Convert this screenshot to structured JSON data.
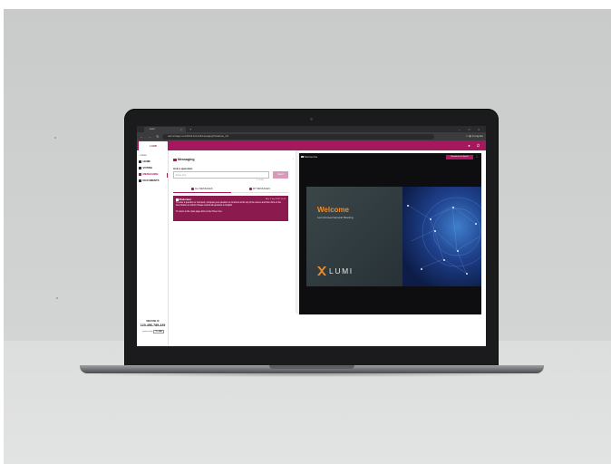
{
  "browser": {
    "tab_title": "Lumi",
    "tab_close": "×",
    "new_tab": "+",
    "window_controls": "– □ ×",
    "nav_buttons": "← → ↻",
    "url": "web.lumiagm.com/#/100-101-102/messaging?locale=en_US",
    "right_controls": "☆ ▤ Incognito"
  },
  "app": {
    "logo_text": "LUMI",
    "header_icons": "● ⏻"
  },
  "sidebar": {
    "back_label": "‹ Close",
    "items": [
      {
        "label": "HOME"
      },
      {
        "label": "VOTING"
      },
      {
        "label": "MESSAGING"
      },
      {
        "label": "DOCUMENTS"
      }
    ],
    "meeting_id_label": "MEETING ID",
    "meeting_id": "123-456-789-229",
    "powered_by": "powered by",
    "lumi_mini": "X LUMI"
  },
  "messaging": {
    "title": "Messaging",
    "collapse": "‹",
    "ask_label": "Ask a question",
    "input_placeholder": "Enter text",
    "send_label": "Send",
    "char_count": "0 / 1000",
    "tab_all": "ALL MESSAGES",
    "tab_mine": "MY MESSAGES",
    "moderator_title": "Moderator",
    "moderator_time": "Mon 7 Sep 2020 10:44",
    "moderator_body1": "To enter a question or comment, compose your question or comment at the top of the screen and then click on the Send button to submit. Please submit all questions in English.",
    "moderator_body2": "To return to the main page click on the Home icon."
  },
  "video": {
    "title": "Webcast live",
    "broadcast_button": "Broadcast to Speak",
    "expand": "⛶",
    "welcome": "Welcome",
    "subtitle": "Lumi Annual General Meeting",
    "lumi_word": "LUMI"
  },
  "colors": {
    "brand": "#a5185d",
    "accent": "#f28c28"
  }
}
